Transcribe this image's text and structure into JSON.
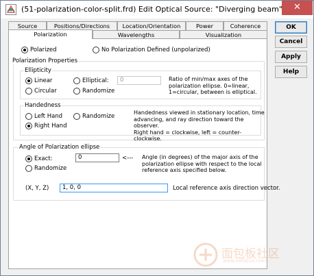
{
  "window": {
    "title": "(51-polarization-color-split.frd) Edit Optical Source: \"Diverging beam\"",
    "close_label": "✕"
  },
  "tabs_row1": [
    "Source",
    "Positions/Directions",
    "Location/Orientation",
    "Power",
    "Coherence"
  ],
  "tabs_row2": [
    "Polarization",
    "Wavelengths",
    "Visualization"
  ],
  "active_tab": "Polarization",
  "buttons": {
    "ok": "OK",
    "cancel": "Cancel",
    "apply": "Apply",
    "help": "Help"
  },
  "polarization_mode": {
    "polarized": "Polarized",
    "none": "No Polarization Defined (unpolarized)",
    "selected": "polarized"
  },
  "properties": {
    "label": "Polarization Properties",
    "ellipticity": {
      "label": "Ellipticity",
      "linear": "Linear",
      "circular": "Circular",
      "elliptical": "Elliptical:",
      "randomize": "Randomize",
      "elliptical_value": "0",
      "selected": "linear",
      "description": [
        "Ratio of min/max axes of the",
        "polarization ellipse.  0=linear,",
        "1=circular, between is elliptical."
      ]
    },
    "handedness": {
      "label": "Handedness",
      "left": "Left Hand",
      "right": "Right Hand",
      "randomize": "Randomize",
      "selected": "right",
      "description": [
        "Handedness viewed in stationary location, time",
        "advancing, and ray direction toward the observer.",
        "Right hand = clockwise,  left = counter-clockwise."
      ]
    }
  },
  "angle": {
    "label": "Angle of Polarization ellipse",
    "exact": "Exact:",
    "randomize": "Randomize",
    "value": "0",
    "arrow": "<---",
    "selected": "exact",
    "description": [
      "Angle (in degrees) of the major axis of the",
      "polarization ellipse with respect to the local",
      "reference axis specified below."
    ],
    "xyz_label": "(X, Y, Z)",
    "xyz_value": "1,  0,  0",
    "xyz_description": "Local reference axis direction vector."
  },
  "watermark": {
    "text": "面包板社区",
    "url": "www.eefocus.com"
  },
  "colors": {
    "close": "#c75050",
    "focus": "#3399ff",
    "panel_border": "#a0a0a0"
  }
}
